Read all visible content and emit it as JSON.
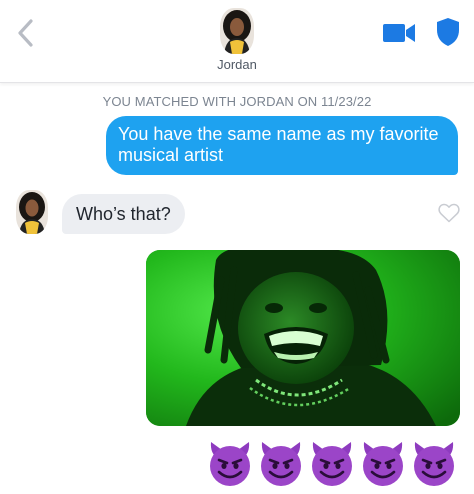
{
  "header": {
    "contact_name": "Jordan",
    "icons": {
      "back": "chevron-left-icon",
      "video": "video-camera-icon",
      "safety": "shield-icon"
    }
  },
  "conversation": {
    "match_notice": "YOU MATCHED WITH JORDAN ON 11/23/22",
    "messages": [
      {
        "from": "me",
        "type": "text",
        "text": "You have the same name as my favorite musical artist"
      },
      {
        "from": "them",
        "type": "text",
        "text": "Who’s that?"
      },
      {
        "from": "me",
        "type": "image",
        "image": "photo-of-smiling-man-green-tint"
      },
      {
        "from": "me",
        "type": "emoji",
        "emoji": [
          "smiling-devil-emoji",
          "smiling-devil-emoji",
          "smiling-devil-emoji",
          "smiling-devil-emoji",
          "smiling-devil-emoji"
        ]
      }
    ],
    "like_icon": "heart-outline-icon"
  },
  "colors": {
    "sent_bubble": "#1ea2f0",
    "received_bubble": "#eceef2",
    "accent_blue": "#1c7ae3",
    "photo_green": "#1fa11a",
    "emoji_purple": "#8e3bbf"
  }
}
